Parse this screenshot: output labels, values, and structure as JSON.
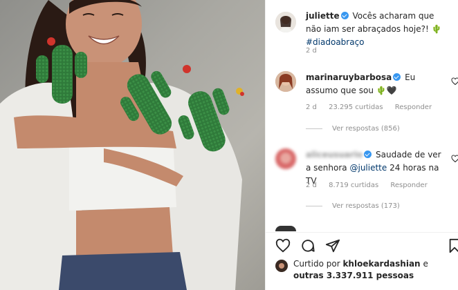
{
  "post": {
    "author": "juliette",
    "caption_text": "Vocês acharam que não iam ser abraçados hoje?!",
    "caption_emoji": "🌵",
    "hashtag": "#diadoabraço",
    "caption_time": "2 d"
  },
  "comments": [
    {
      "username": "marinaruybarbosa",
      "text": "Eu assumo que sou",
      "emoji": "🌵🖤",
      "time": "2 d",
      "likes": "23.295 curtidas",
      "reply_label": "Responder",
      "view_replies": "Ver respostas (856)"
    },
    {
      "username": "aliceusuario",
      "text_before": "Saudade de ver a senhora",
      "mention": "@juliette",
      "text_after": "24 horas na TV",
      "time": "2 d",
      "likes": "8.719 curtidas",
      "reply_label": "Responder",
      "view_replies": "Ver respostas (173)"
    }
  ],
  "footer": {
    "liked_by_prefix": "Curtido por",
    "liked_by_user": "khloekardashian",
    "liked_by_connector": "e",
    "liked_by_others": "outras 3.337.911 pessoas"
  },
  "icons": [
    "heart-icon",
    "comment-icon",
    "share-icon",
    "bookmark-icon",
    "verified-icon"
  ],
  "colors": {
    "link": "#00376b",
    "verified": "#3897f0",
    "meta": "#8e8e8e",
    "text": "#262626"
  }
}
